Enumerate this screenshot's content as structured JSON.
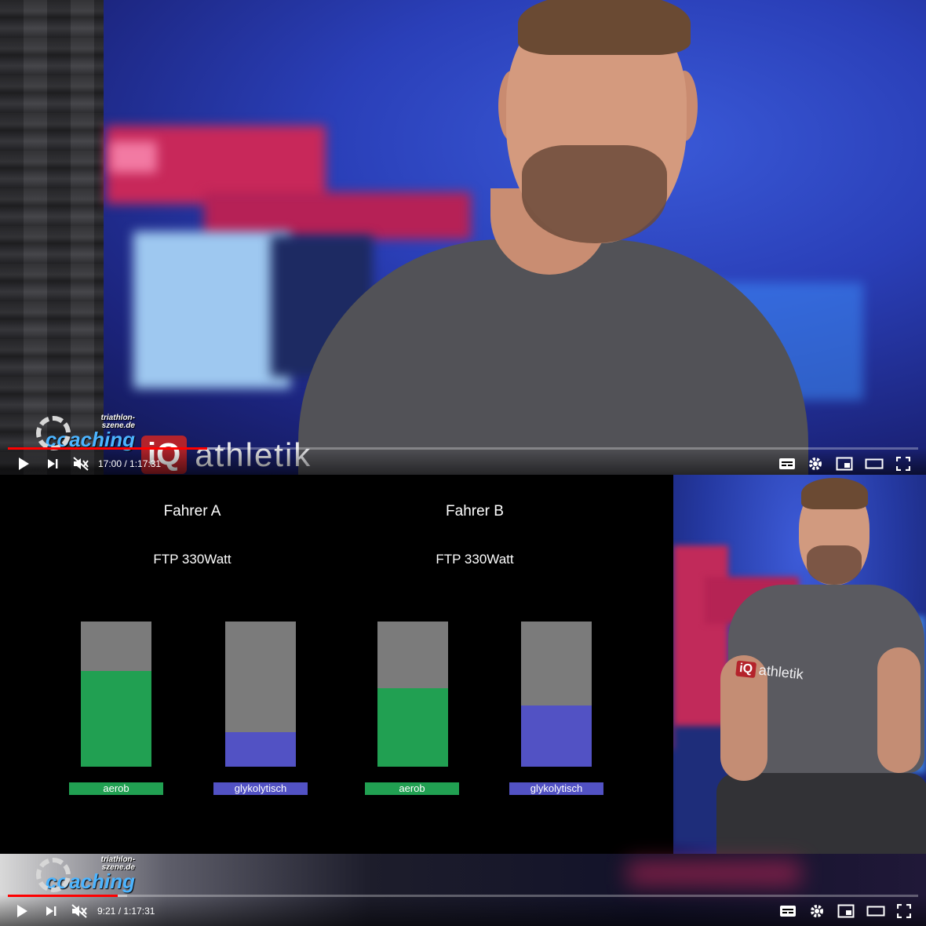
{
  "top_player": {
    "channel_logo": {
      "line1": "triathlon-",
      "line2": "szene.de",
      "brand": "coaching"
    },
    "shirt_logo": {
      "iq": "iQ",
      "brand": "athletik"
    },
    "controls": {
      "current_time": "17:00",
      "separator": " / ",
      "duration": "1:17:31",
      "progress_fraction": 0.219
    }
  },
  "bottom_player": {
    "channel_logo": {
      "line1": "triathlon-",
      "line2": "szene.de",
      "brand": "coaching"
    },
    "side_shirt_logo": {
      "iq": "iQ",
      "brand": "athletik"
    },
    "controls": {
      "current_time": "9:21",
      "separator": " / ",
      "duration": "1:17:31",
      "progress_fraction": 0.121
    }
  },
  "slide": {
    "drivers": [
      {
        "name": "Fahrer A",
        "ftp": "FTP 330Watt"
      },
      {
        "name": "Fahrer B",
        "ftp": "FTP 330Watt"
      }
    ],
    "bars": [
      {
        "label": "aerob",
        "fill_fraction": 0.66,
        "color": "#21a052"
      },
      {
        "label": "glykolytisch",
        "fill_fraction": 0.24,
        "color": "#5252c4"
      },
      {
        "label": "aerob",
        "fill_fraction": 0.54,
        "color": "#21a052"
      },
      {
        "label": "glykolytisch",
        "fill_fraction": 0.42,
        "color": "#5252c4"
      }
    ]
  },
  "colors": {
    "progress": "#ff0000",
    "bar_background": "#7b7b7b",
    "iq_red": "#b4232b"
  },
  "icons": [
    "play-icon",
    "next-icon",
    "mute-icon",
    "subtitles-icon",
    "settings-icon",
    "miniplayer-icon",
    "theater-icon",
    "fullscreen-icon"
  ]
}
